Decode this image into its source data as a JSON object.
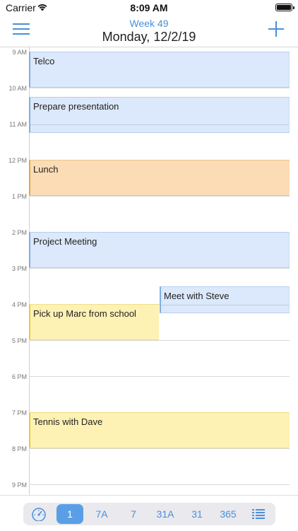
{
  "status": {
    "carrier": "Carrier",
    "time": "8:09 AM"
  },
  "header": {
    "week": "Week 49",
    "date": "Monday, 12/2/19"
  },
  "hours": [
    "9 AM",
    "10 AM",
    "11 AM",
    "12 PM",
    "1 PM",
    "2 PM",
    "3 PM",
    "4 PM",
    "5 PM",
    "6 PM",
    "7 PM",
    "8 PM",
    "9 PM"
  ],
  "events": [
    {
      "title": "Telco",
      "color": "blue"
    },
    {
      "title": "Prepare presentation",
      "color": "blue"
    },
    {
      "title": "Lunch",
      "color": "orange"
    },
    {
      "title": "Project Meeting",
      "color": "blue"
    },
    {
      "title": "Meet with Steve",
      "color": "blue"
    },
    {
      "title": "Pick up Marc from school",
      "color": "yellow"
    },
    {
      "title": "Tennis with Dave",
      "color": "yellow"
    }
  ],
  "toolbar": {
    "items": [
      {
        "label": "1",
        "selected": true
      },
      {
        "label": "7A",
        "selected": false
      },
      {
        "label": "7",
        "selected": false
      },
      {
        "label": "31A",
        "selected": false
      },
      {
        "label": "31",
        "selected": false
      },
      {
        "label": "365",
        "selected": false
      }
    ]
  },
  "colors": {
    "accent": "#4a90d9",
    "selected": "#5a9fe6",
    "blue_event": "#dce8fb",
    "orange_event": "#fbdcb5",
    "yellow_event": "#fdf1b3"
  }
}
